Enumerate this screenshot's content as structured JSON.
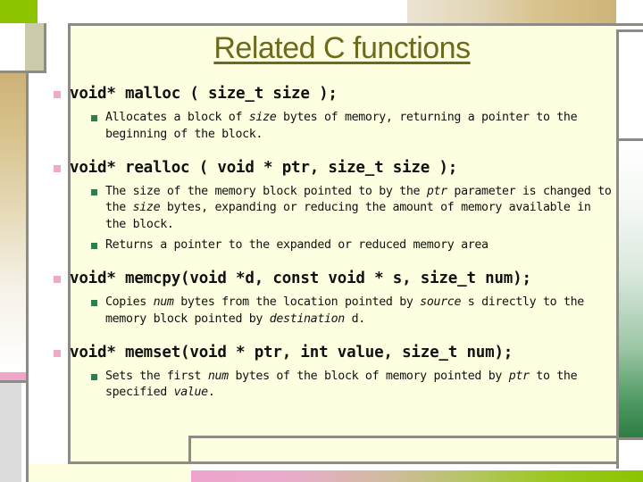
{
  "slide": {
    "title": "Related C functions",
    "colors": {
      "panel_background": "#fdffe0",
      "title": "#6b6a1e",
      "frame_rule": "#8c8c84",
      "level1_bullet": "#f0a9c8",
      "level2_bullet": "#2f7d4f",
      "accent_green": "#8cc400",
      "accent_pink": "#eda6c8",
      "accent_tan": "#ceb478"
    },
    "bullets": [
      {
        "signature": "void* malloc ( size_t size );",
        "details": [
          {
            "runs": [
              {
                "text": "Allocates a block of ",
                "italic": false
              },
              {
                "text": "size",
                "italic": true
              },
              {
                "text": " bytes of memory, returning a pointer to the beginning of the block.",
                "italic": false
              }
            ]
          }
        ]
      },
      {
        "signature": "void* realloc ( void * ptr, size_t size );",
        "details": [
          {
            "runs": [
              {
                "text": "The size of the memory block pointed to by the ",
                "italic": false
              },
              {
                "text": "ptr",
                "italic": true
              },
              {
                "text": " parameter is changed to the ",
                "italic": false
              },
              {
                "text": "size",
                "italic": true
              },
              {
                "text": " bytes, expanding or reducing the amount of memory available in the block.",
                "italic": false
              }
            ]
          },
          {
            "runs": [
              {
                "text": "Returns a pointer to the expanded or reduced memory area",
                "italic": false
              }
            ]
          }
        ]
      },
      {
        "signature": "void* memcpy(void *d, const void * s, size_t num);",
        "details": [
          {
            "runs": [
              {
                "text": "Copies ",
                "italic": false
              },
              {
                "text": "num",
                "italic": true
              },
              {
                "text": " bytes from the location pointed by ",
                "italic": false
              },
              {
                "text": "source",
                "italic": true
              },
              {
                "text": " s directly to the memory block pointed by ",
                "italic": false
              },
              {
                "text": "destination",
                "italic": true
              },
              {
                "text": " d.",
                "italic": false
              }
            ]
          }
        ]
      },
      {
        "signature": "void* memset(void * ptr, int value, size_t num);",
        "details": [
          {
            "runs": [
              {
                "text": "Sets the first ",
                "italic": false
              },
              {
                "text": "num",
                "italic": true
              },
              {
                "text": " bytes of the block of memory pointed by ",
                "italic": false
              },
              {
                "text": "ptr",
                "italic": true
              },
              {
                "text": " to the specified ",
                "italic": false
              },
              {
                "text": "value",
                "italic": true
              },
              {
                "text": ".",
                "italic": false
              }
            ]
          }
        ]
      }
    ]
  }
}
